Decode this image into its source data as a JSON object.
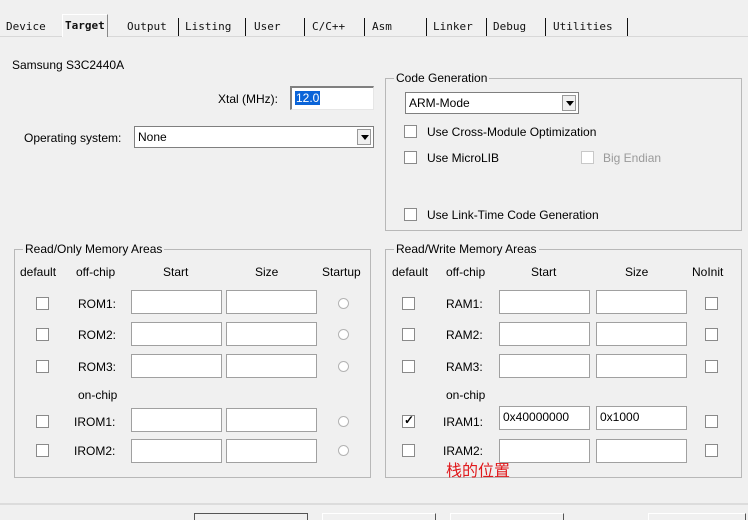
{
  "tabs": [
    {
      "label": "Device"
    },
    {
      "label": "Target"
    },
    {
      "label": "Output"
    },
    {
      "label": "Listing"
    },
    {
      "label": "User"
    },
    {
      "label": "C/C++"
    },
    {
      "label": "Asm"
    },
    {
      "label": "Linker"
    },
    {
      "label": "Debug"
    },
    {
      "label": "Utilities"
    }
  ],
  "device_name": "Samsung S3C2440A",
  "xtal": {
    "label": "Xtal (MHz):",
    "value": "12.0"
  },
  "os": {
    "label": "Operating system:",
    "value": "None"
  },
  "code_generation": {
    "title": "Code Generation",
    "mode": "ARM-Mode",
    "cross_module": "Use Cross-Module Optimization",
    "microlib": "Use MicroLIB",
    "big_endian": "Big Endian",
    "link_time": "Use Link-Time Code Generation"
  },
  "ro_memory": {
    "title": "Read/Only Memory Areas",
    "headers": {
      "default": "default",
      "offchip": "off-chip",
      "start": "Start",
      "size": "Size",
      "startup": "Startup"
    },
    "onchip_label": "on-chip",
    "rows": [
      {
        "label": "ROM1:",
        "start": "",
        "size": "",
        "default": false
      },
      {
        "label": "ROM2:",
        "start": "",
        "size": "",
        "default": false
      },
      {
        "label": "ROM3:",
        "start": "",
        "size": "",
        "default": false
      },
      {
        "label": "IROM1:",
        "start": "",
        "size": "",
        "default": false
      },
      {
        "label": "IROM2:",
        "start": "",
        "size": "",
        "default": false
      }
    ]
  },
  "rw_memory": {
    "title": "Read/Write Memory Areas",
    "headers": {
      "default": "default",
      "offchip": "off-chip",
      "start": "Start",
      "size": "Size",
      "noinit": "NoInit"
    },
    "onchip_label": "on-chip",
    "rows": [
      {
        "label": "RAM1:",
        "start": "",
        "size": "",
        "default": false
      },
      {
        "label": "RAM2:",
        "start": "",
        "size": "",
        "default": false
      },
      {
        "label": "RAM3:",
        "start": "",
        "size": "",
        "default": false
      },
      {
        "label": "IRAM1:",
        "start": "0x40000000",
        "size": "0x1000",
        "default": true
      },
      {
        "label": "IRAM2:",
        "start": "",
        "size": "",
        "default": false
      }
    ]
  },
  "annotation": "栈的位置",
  "colors": {
    "annotation": "#e0191c",
    "selection": "#0a64d8"
  }
}
